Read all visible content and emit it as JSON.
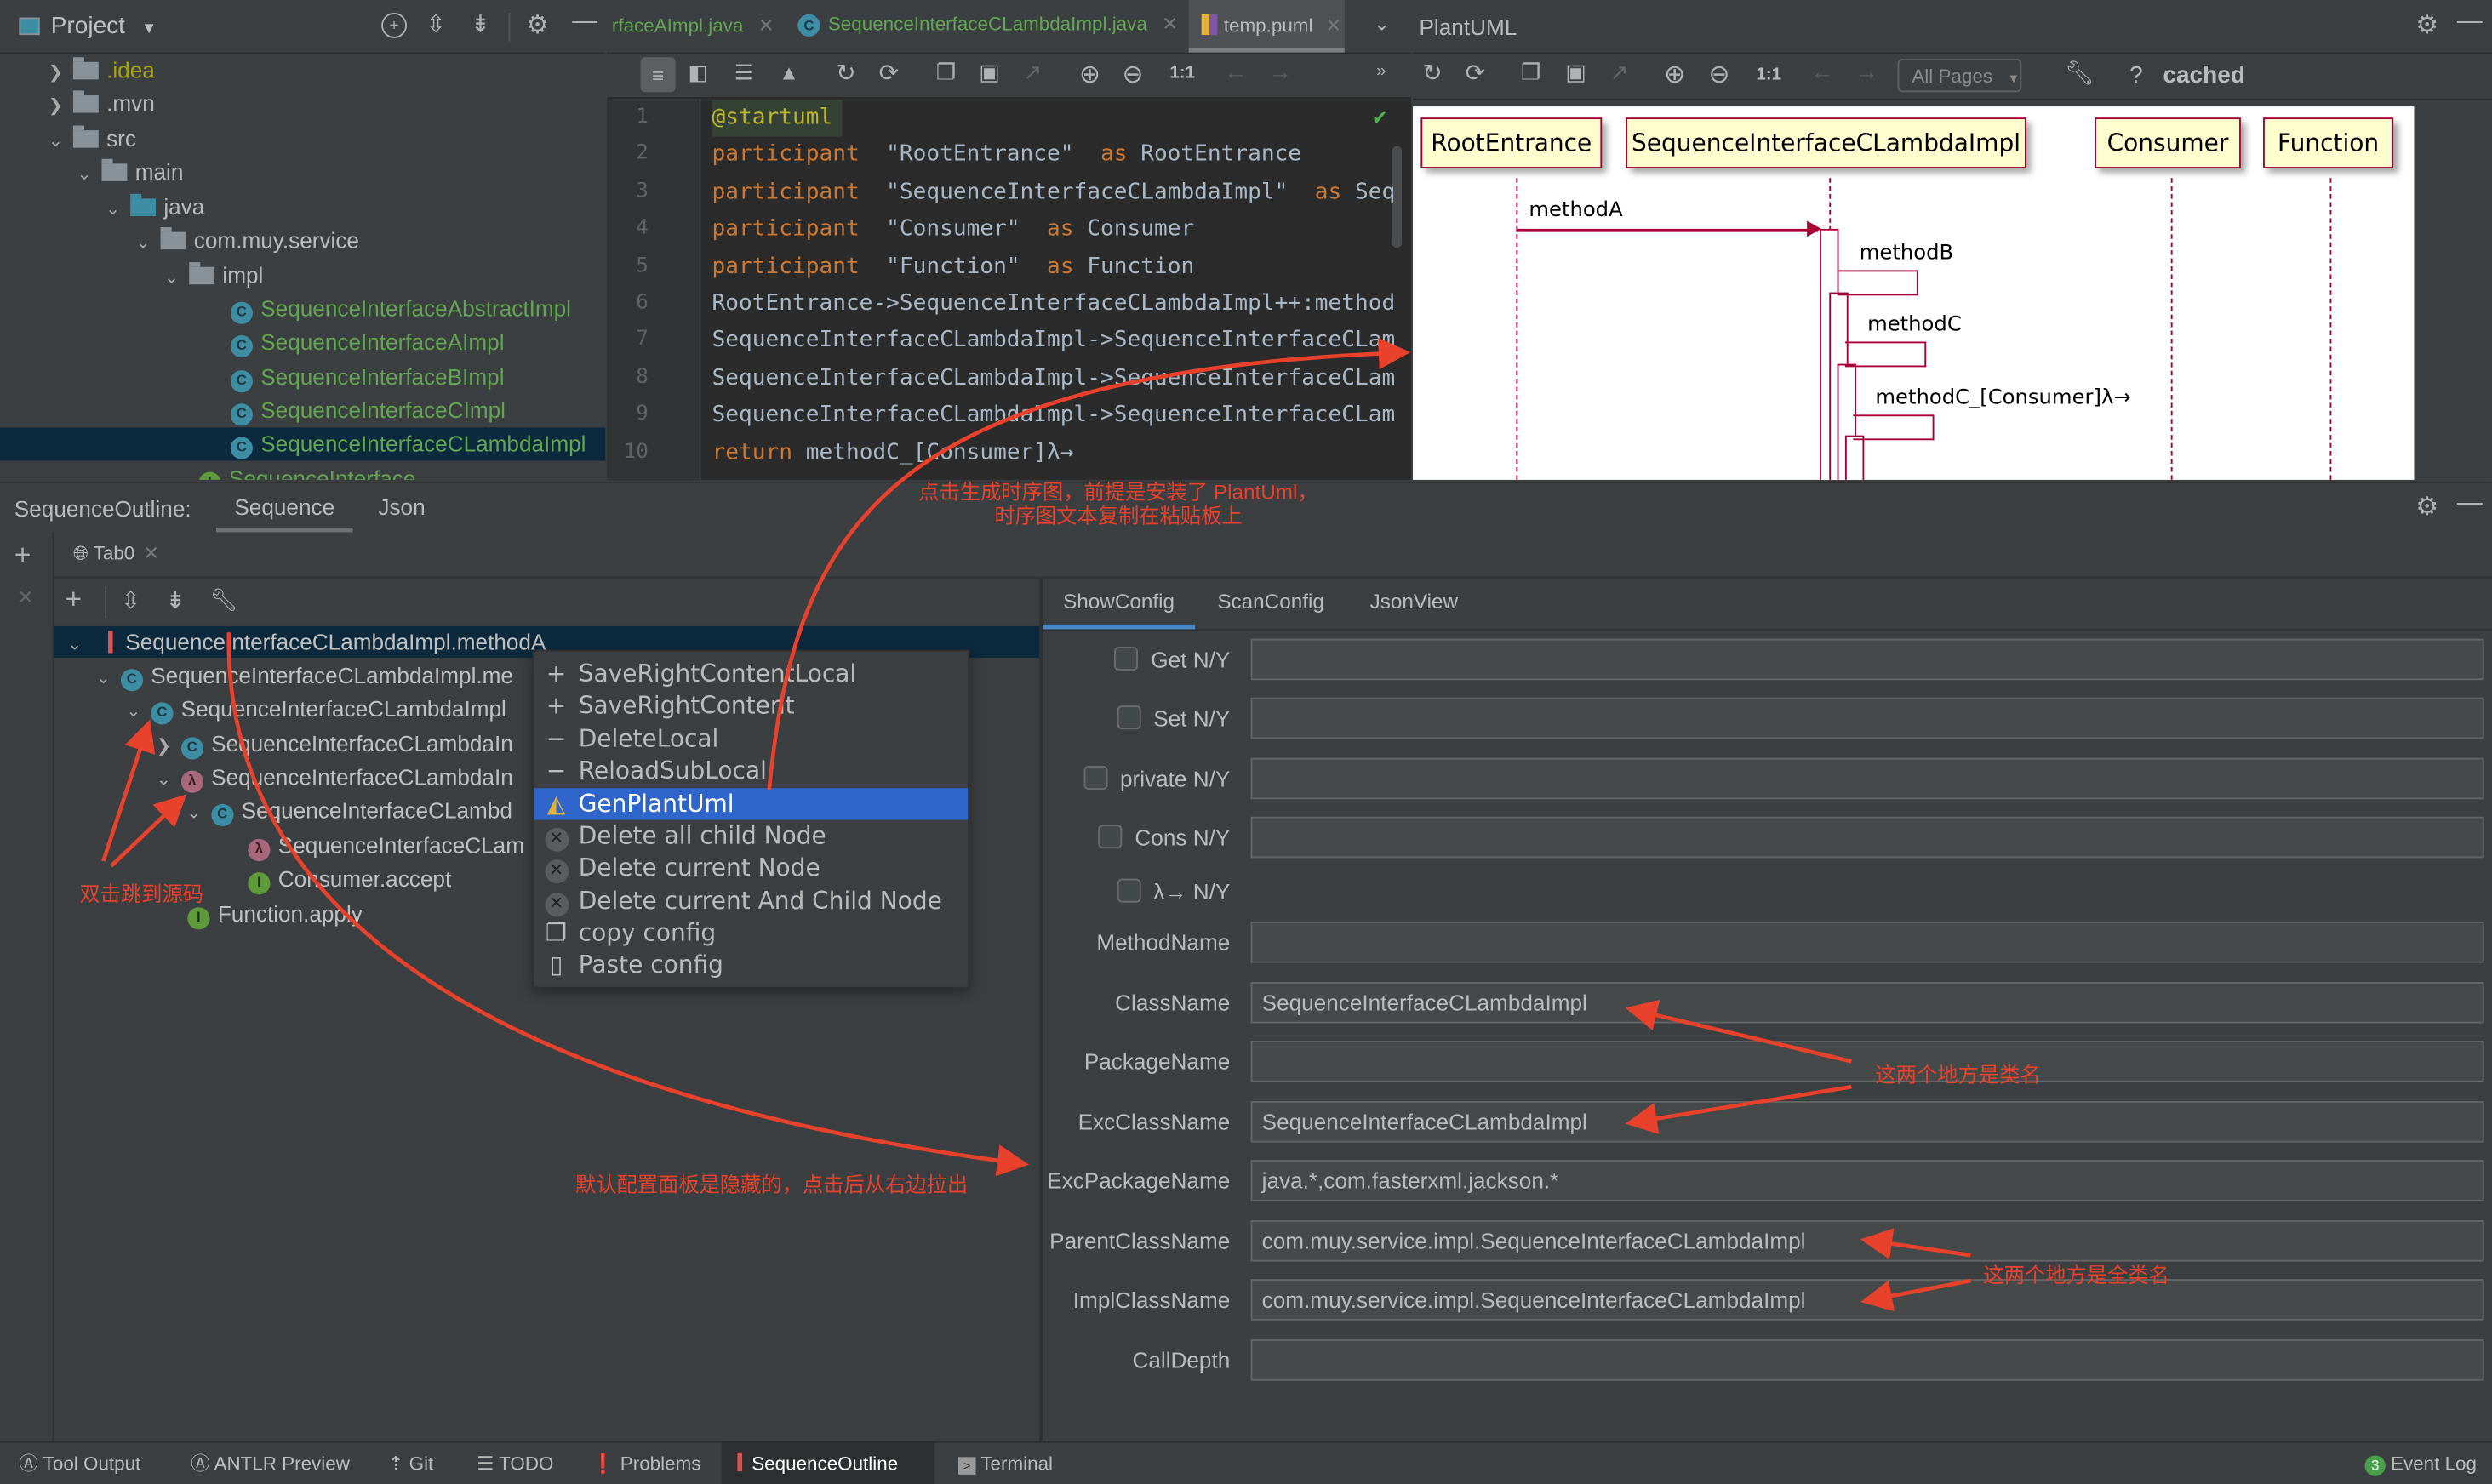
{
  "project_panel": {
    "title": "Project",
    "tree": [
      {
        "label": ".idea",
        "type": "folder",
        "expanded": false,
        "depth": 0,
        "color": "olive"
      },
      {
        "label": ".mvn",
        "type": "folder",
        "expanded": false,
        "depth": 0
      },
      {
        "label": "src",
        "type": "folder",
        "expanded": true,
        "depth": 0
      },
      {
        "label": "main",
        "type": "folder",
        "expanded": true,
        "depth": 1
      },
      {
        "label": "java",
        "type": "source-folder",
        "expanded": true,
        "depth": 2
      },
      {
        "label": "com.muy.service",
        "type": "package",
        "expanded": true,
        "depth": 3
      },
      {
        "label": "impl",
        "type": "package",
        "expanded": true,
        "depth": 4
      },
      {
        "label": "SequenceInterfaceAbstractImpl",
        "type": "abstract-class",
        "depth": 5
      },
      {
        "label": "SequenceInterfaceAImpl",
        "type": "class",
        "depth": 5
      },
      {
        "label": "SequenceInterfaceBImpl",
        "type": "class",
        "depth": 5
      },
      {
        "label": "SequenceInterfaceCImpl",
        "type": "class",
        "depth": 5
      },
      {
        "label": "SequenceInterfaceCLambdaImpl",
        "type": "class",
        "depth": 5,
        "selected": true
      },
      {
        "label": "SequenceInterface",
        "type": "interface",
        "depth": 4
      }
    ]
  },
  "editor": {
    "tabs": [
      {
        "label": "rfaceAImpl.java",
        "active": false
      },
      {
        "label": "SequenceInterfaceCLambdaImpl.java",
        "active": false,
        "icon": "class-icon"
      },
      {
        "label": "temp.puml",
        "active": true,
        "icon": "puml-icon"
      }
    ],
    "zoom_reset_label": "1:1",
    "lines": [
      {
        "n": "1",
        "parts": [
          {
            "t": "@startuml",
            "c": "anno"
          }
        ]
      },
      {
        "n": "2",
        "parts": [
          {
            "t": "participant",
            "c": "kw"
          },
          {
            "t": "  \"RootEntrance\"  ",
            "c": "s"
          },
          {
            "t": "as",
            "c": "kw"
          },
          {
            "t": " RootEntrance",
            "c": "s"
          }
        ]
      },
      {
        "n": "3",
        "parts": [
          {
            "t": "participant",
            "c": "kw"
          },
          {
            "t": "  \"SequenceInterfaceCLambdaImpl\"  ",
            "c": "s"
          },
          {
            "t": "as",
            "c": "kw"
          },
          {
            "t": " Seq",
            "c": "s"
          }
        ]
      },
      {
        "n": "4",
        "parts": [
          {
            "t": "participant",
            "c": "kw"
          },
          {
            "t": "  \"Consumer\"  ",
            "c": "s"
          },
          {
            "t": "as",
            "c": "kw"
          },
          {
            "t": " Consumer",
            "c": "s"
          }
        ]
      },
      {
        "n": "5",
        "parts": [
          {
            "t": "participant",
            "c": "kw"
          },
          {
            "t": "  \"Function\"  ",
            "c": "s"
          },
          {
            "t": "as",
            "c": "kw"
          },
          {
            "t": " Function",
            "c": "s"
          }
        ]
      },
      {
        "n": "6",
        "parts": [
          {
            "t": "RootEntrance->SequenceInterfaceCLambdaImpl++:method",
            "c": "s"
          }
        ]
      },
      {
        "n": "7",
        "parts": [
          {
            "t": "SequenceInterfaceCLambdaImpl->SequenceInterfaceCLam",
            "c": "s"
          }
        ]
      },
      {
        "n": "8",
        "parts": [
          {
            "t": "SequenceInterfaceCLambdaImpl->SequenceInterfaceCLam",
            "c": "s"
          }
        ]
      },
      {
        "n": "9",
        "parts": [
          {
            "t": "SequenceInterfaceCLambdaImpl->SequenceInterfaceCLam",
            "c": "s"
          }
        ]
      },
      {
        "n": "10",
        "parts": [
          {
            "t": "return",
            "c": "kw"
          },
          {
            "t": " methodC_[Consumer]λ→",
            "c": "s"
          }
        ]
      }
    ]
  },
  "plantuml": {
    "title": "PlantUML",
    "pages_select": "All Pages",
    "zoom_reset_label": "1:1",
    "help_label": "?",
    "status": "cached",
    "participants": [
      "RootEntrance",
      "SequenceInterfaceCLambdaImpl",
      "Consumer",
      "Function"
    ],
    "messages": [
      "methodA",
      "methodB",
      "methodC",
      "methodC_[Consumer]λ→"
    ]
  },
  "outline": {
    "title": "SequenceOutline:",
    "tabs": [
      {
        "label": "Sequence",
        "active": true
      },
      {
        "label": "Json",
        "active": false
      }
    ],
    "inner_tab": "Tab0",
    "tree": [
      {
        "label": "SequenceInterfaceCLambdaImpl.methodA",
        "icon": "sequence-root",
        "depth": 0,
        "expanded": true,
        "selected": true
      },
      {
        "label": "SequenceInterfaceCLambdaImpl.me",
        "icon": "class",
        "depth": 1,
        "expanded": true
      },
      {
        "label": "SequenceInterfaceCLambdaImpl",
        "icon": "class",
        "depth": 2,
        "expanded": true
      },
      {
        "label": "SequenceInterfaceCLambdaIn",
        "icon": "class",
        "depth": 3,
        "expanded": false
      },
      {
        "label": "SequenceInterfaceCLambdaIn",
        "icon": "lambda",
        "depth": 3,
        "expanded": true
      },
      {
        "label": "SequenceInterfaceCLambd",
        "icon": "class",
        "depth": 4,
        "expanded": true
      },
      {
        "label": "SequenceInterfaceCLam",
        "icon": "lambda",
        "depth": 5
      },
      {
        "label": "Consumer.accept",
        "icon": "interface",
        "depth": 5
      },
      {
        "label": "Function.apply",
        "icon": "interface",
        "depth": 3
      }
    ]
  },
  "context_menu": {
    "items": [
      {
        "label": "SaveRightContentLocal",
        "icon": "plus"
      },
      {
        "label": "SaveRightContent",
        "icon": "plus"
      },
      {
        "label": "DeleteLocal",
        "icon": "minus"
      },
      {
        "label": "ReloadSubLocal",
        "icon": "minus"
      },
      {
        "label": "GenPlantUml",
        "icon": "plantuml",
        "selected": true
      },
      {
        "label": "Delete all child Node",
        "icon": "close-circle"
      },
      {
        "label": "Delete current Node",
        "icon": "close-circle"
      },
      {
        "label": "Delete current And Child Node",
        "icon": "close-circle"
      },
      {
        "label": "copy config",
        "icon": "copy"
      },
      {
        "label": "Paste config",
        "icon": "paste"
      }
    ]
  },
  "config_panel": {
    "tabs": [
      {
        "label": "ShowConfig",
        "active": true
      },
      {
        "label": "ScanConfig",
        "active": false
      },
      {
        "label": "JsonView",
        "active": false
      }
    ],
    "fields": [
      {
        "label": "Get N/Y",
        "checkbox": true,
        "checked": false,
        "value": "",
        "has_input": true
      },
      {
        "label": "Set N/Y",
        "checkbox": true,
        "checked": false,
        "value": "",
        "has_input": true
      },
      {
        "label": "private N/Y",
        "checkbox": true,
        "checked": false,
        "value": "",
        "has_input": true
      },
      {
        "label": "Cons N/Y",
        "checkbox": true,
        "checked": false,
        "value": "",
        "has_input": true
      },
      {
        "label": "λ→ N/Y",
        "checkbox": true,
        "checked": false,
        "value": "",
        "has_input": false
      },
      {
        "label": "MethodName",
        "checkbox": false,
        "value": "",
        "has_input": true
      },
      {
        "label": "ClassName",
        "checkbox": false,
        "value": "SequenceInterfaceCLambdaImpl",
        "has_input": true
      },
      {
        "label": "PackageName",
        "checkbox": false,
        "value": "",
        "has_input": true
      },
      {
        "label": "ExcClassName",
        "checkbox": false,
        "value": "SequenceInterfaceCLambdaImpl",
        "has_input": true
      },
      {
        "label": "ExcPackageName",
        "checkbox": false,
        "value": "java.*,com.fasterxml.jackson.*",
        "has_input": true
      },
      {
        "label": "ParentClassName",
        "checkbox": false,
        "value": "com.muy.service.impl.SequenceInterfaceCLambdaImpl",
        "has_input": true
      },
      {
        "label": "ImplClassName",
        "checkbox": false,
        "value": "com.muy.service.impl.SequenceInterfaceCLambdaImpl",
        "has_input": true
      },
      {
        "label": "CallDepth",
        "checkbox": false,
        "value": "",
        "has_input": true
      }
    ]
  },
  "annotations": {
    "gen_plantuml_line1": "点击生成时序图，前提是安装了 PlantUml，",
    "gen_plantuml_line2": "时序图文本复制在粘贴板上",
    "double_click": "双击跳到源码",
    "config_hidden": "默认配置面板是隐藏的，点击后从右边拉出",
    "class_name": "这两个地方是类名",
    "full_class_name": "这两个地方是全类名",
    "color": "#e8412c"
  },
  "status_bar": {
    "items": [
      {
        "label": "Tool Output",
        "icon": "antlr-icon"
      },
      {
        "label": "ANTLR Preview",
        "icon": "antlr-icon"
      },
      {
        "label": "Git",
        "icon": "git-icon"
      },
      {
        "label": "TODO",
        "icon": "todo-icon"
      },
      {
        "label": "Problems",
        "icon": "problems-icon"
      },
      {
        "label": "SequenceOutline",
        "icon": "sequence-icon",
        "active": true
      },
      {
        "label": "Terminal",
        "icon": "terminal-icon"
      }
    ],
    "event_log": {
      "label": "Event Log",
      "count": "3"
    }
  }
}
